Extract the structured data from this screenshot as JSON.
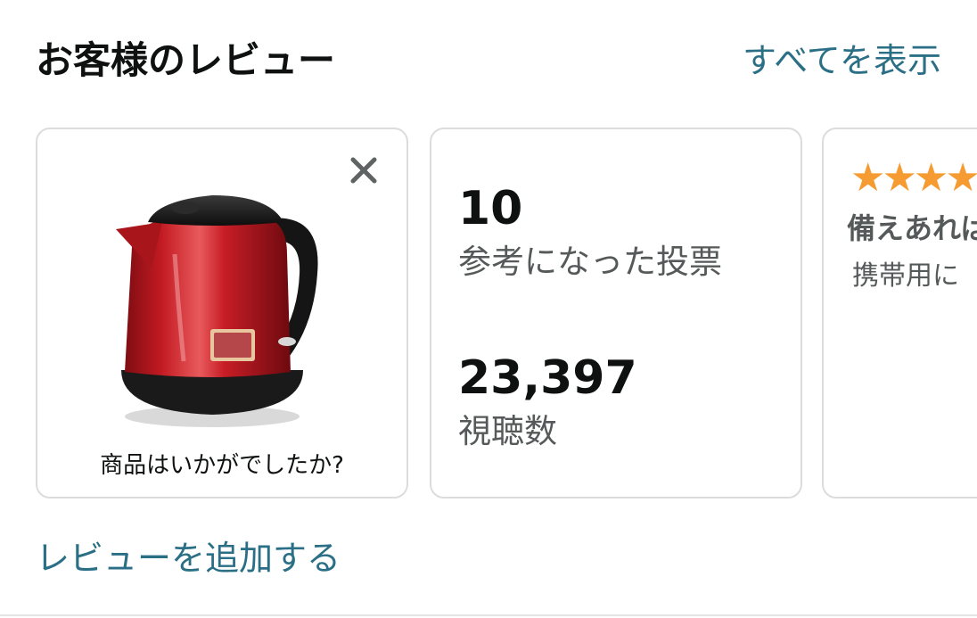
{
  "section": {
    "title": "お客様のレビュー",
    "see_all_label": "すべてを表示"
  },
  "product_card": {
    "question": "商品はいかがでしたか?",
    "close_icon": "close-icon",
    "image": "red-electric-kettle",
    "kettle_color": "#c21a22"
  },
  "stats_card": {
    "helpful_votes": "10",
    "helpful_votes_label": "参考になった投票",
    "views": "23,397",
    "views_label": "視聴数"
  },
  "review_card": {
    "stars": "★★★★",
    "star_color": "#f59b31",
    "title": "備えあれば",
    "body": "携帯用に"
  },
  "add_review_label": "レビューを追加する",
  "colors": {
    "link": "#2a6f86",
    "text": "#0f1111",
    "secondary_text": "#565959",
    "card_border": "#dcdcdc"
  }
}
